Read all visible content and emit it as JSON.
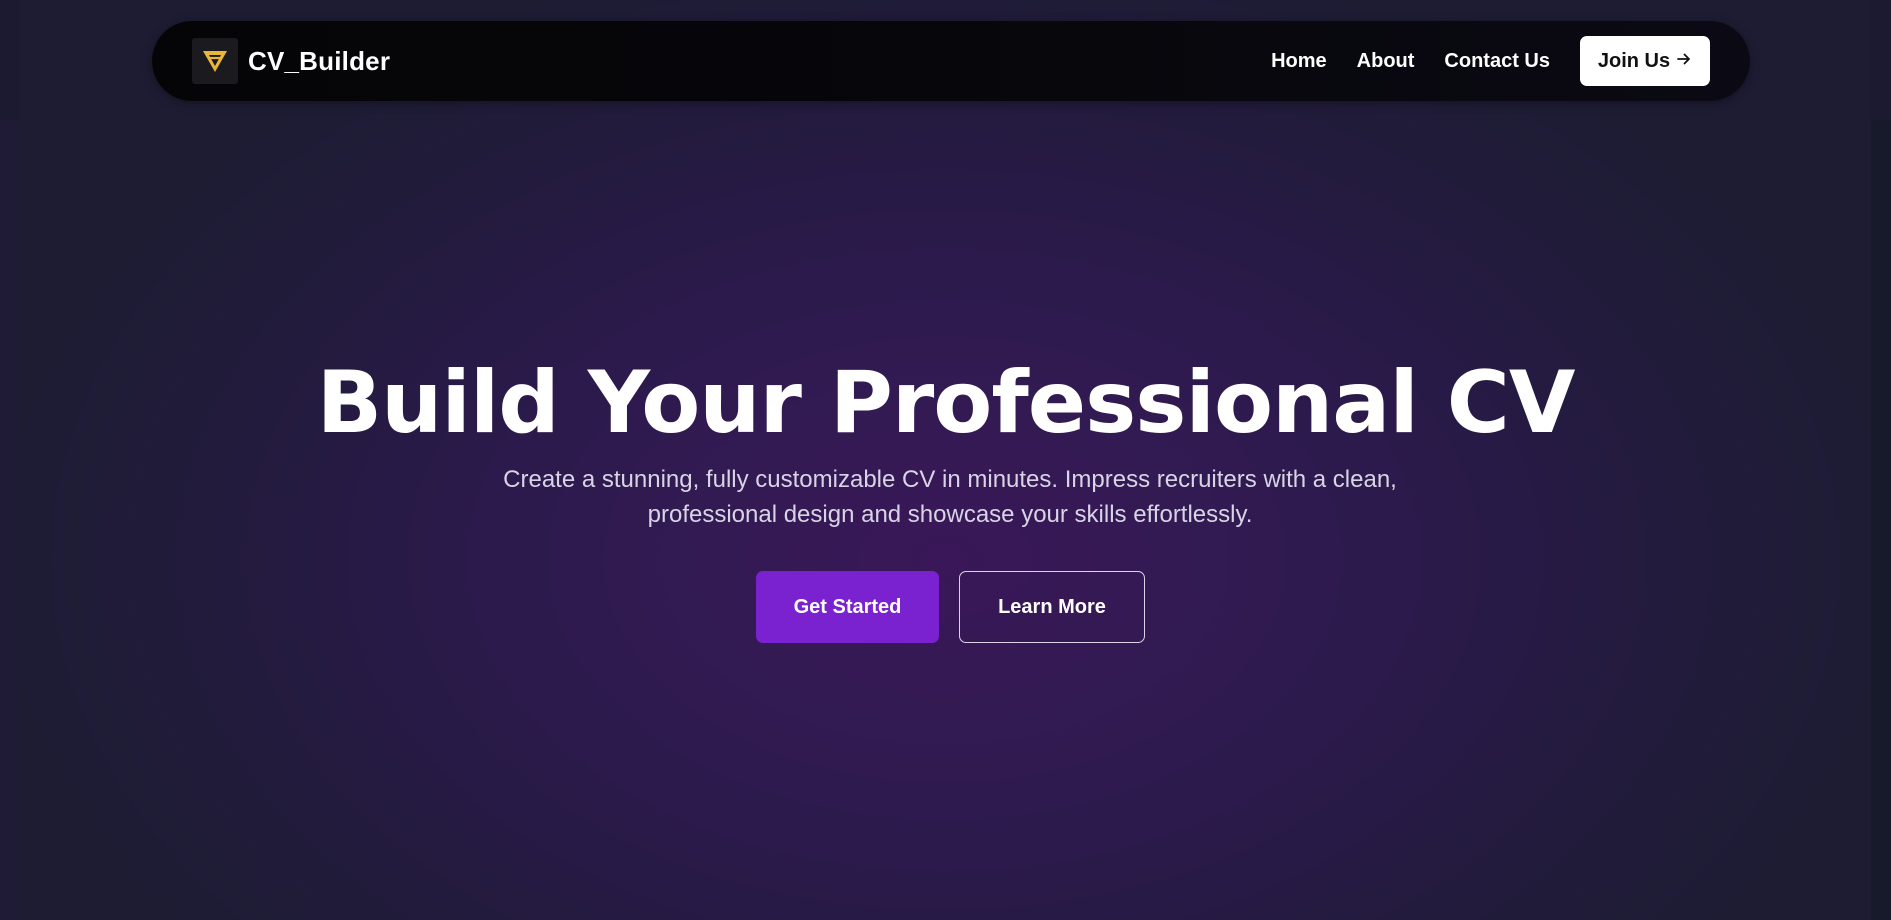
{
  "navbar": {
    "brand": {
      "name": "CV_Builder",
      "logo_icon": "chevron-v-logo-icon",
      "logo_color": "#e8b63a"
    },
    "links": [
      {
        "label": "Home"
      },
      {
        "label": "About"
      },
      {
        "label": "Contact Us"
      }
    ],
    "cta": {
      "label": "Join Us",
      "icon": "arrow-right-icon"
    }
  },
  "hero": {
    "title": "Build Your Professional CV",
    "subtitle_line1": "Create a stunning, fully customizable CV in minutes. Impress recruiters with a clean,",
    "subtitle_line2": "professional design and showcase your skills effortlessly.",
    "primary_button": "Get Started",
    "secondary_button": "Learn More"
  },
  "colors": {
    "accent": "#7a22cf",
    "background": "#1b1a30",
    "hero_glow": "#3a1758",
    "navbar": "#050507"
  }
}
